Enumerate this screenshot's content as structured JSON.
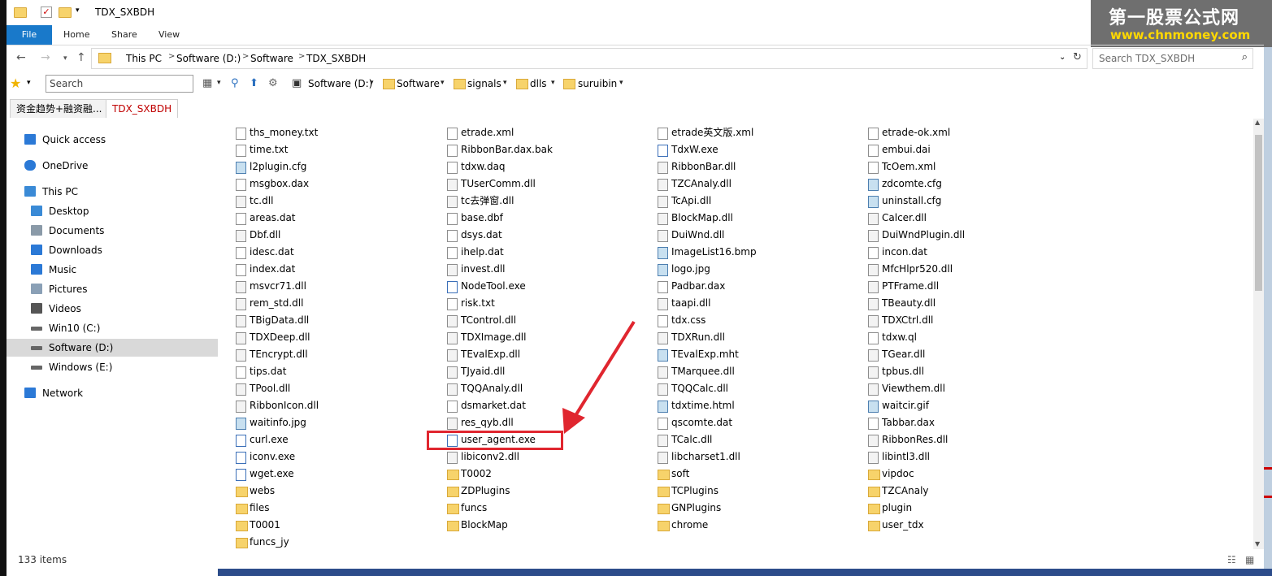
{
  "window": {
    "title": "TDX_SXBDH"
  },
  "ribbon": {
    "tabs": [
      "File",
      "Home",
      "Share",
      "View"
    ]
  },
  "address": {
    "crumbs": [
      "This PC",
      "Software (D:)",
      "Software",
      "TDX_SXBDH"
    ],
    "search_placeholder": "Search TDX_SXBDH"
  },
  "toolbar": {
    "search": "Search",
    "locations": [
      "Software (D:)",
      "Software",
      "signals",
      "dlls",
      "suruibin"
    ]
  },
  "folder_tabs": [
    "资金趋势+融资融...",
    "TDX_SXBDH"
  ],
  "nav": {
    "items": [
      {
        "label": "Quick access",
        "icon": "star-icon"
      },
      {
        "label": "OneDrive",
        "icon": "cloud-icon"
      },
      {
        "label": "This PC",
        "icon": "computer-icon"
      },
      {
        "label": "Desktop",
        "icon": "desktop-icon"
      },
      {
        "label": "Documents",
        "icon": "documents-icon"
      },
      {
        "label": "Downloads",
        "icon": "download-icon"
      },
      {
        "label": "Music",
        "icon": "music-icon"
      },
      {
        "label": "Pictures",
        "icon": "pictures-icon"
      },
      {
        "label": "Videos",
        "icon": "videos-icon"
      },
      {
        "label": "Win10 (C:)",
        "icon": "drive-icon"
      },
      {
        "label": "Software (D:)",
        "icon": "drive-icon"
      },
      {
        "label": "Windows (E:)",
        "icon": "drive-icon"
      },
      {
        "label": "Network",
        "icon": "network-icon"
      }
    ],
    "selected": "Software (D:)"
  },
  "files": {
    "columns": [
      [
        {
          "name": "ths_money.txt",
          "type": "file"
        },
        {
          "name": "time.txt",
          "type": "file"
        },
        {
          "name": "l2plugin.cfg",
          "type": "img"
        },
        {
          "name": "msgbox.dax",
          "type": "file"
        },
        {
          "name": "tc.dll",
          "type": "dll"
        },
        {
          "name": "areas.dat",
          "type": "file"
        },
        {
          "name": "Dbf.dll",
          "type": "dll"
        },
        {
          "name": "idesc.dat",
          "type": "file"
        },
        {
          "name": "index.dat",
          "type": "file"
        },
        {
          "name": "msvcr71.dll",
          "type": "dll"
        },
        {
          "name": "rem_std.dll",
          "type": "dll"
        },
        {
          "name": "TBigData.dll",
          "type": "dll"
        },
        {
          "name": "TDXDeep.dll",
          "type": "dll"
        },
        {
          "name": "TEncrypt.dll",
          "type": "dll"
        },
        {
          "name": "tips.dat",
          "type": "file"
        },
        {
          "name": "TPool.dll",
          "type": "dll"
        },
        {
          "name": "RibbonIcon.dll",
          "type": "dll"
        },
        {
          "name": "waitinfo.jpg",
          "type": "img"
        },
        {
          "name": "curl.exe",
          "type": "exe"
        },
        {
          "name": "iconv.exe",
          "type": "exe"
        },
        {
          "name": "wget.exe",
          "type": "exe"
        },
        {
          "name": "webs",
          "type": "folder"
        },
        {
          "name": "files",
          "type": "folder"
        },
        {
          "name": "T0001",
          "type": "folder"
        },
        {
          "name": "funcs_jy",
          "type": "folder"
        }
      ],
      [
        {
          "name": "etrade.xml",
          "type": "file"
        },
        {
          "name": "RibbonBar.dax.bak",
          "type": "file"
        },
        {
          "name": "tdxw.daq",
          "type": "file"
        },
        {
          "name": "TUserComm.dll",
          "type": "dll"
        },
        {
          "name": "tc去弹窗.dll",
          "type": "dll"
        },
        {
          "name": "base.dbf",
          "type": "file"
        },
        {
          "name": "dsys.dat",
          "type": "file"
        },
        {
          "name": "ihelp.dat",
          "type": "file"
        },
        {
          "name": "invest.dll",
          "type": "dll"
        },
        {
          "name": "NodeTool.exe",
          "type": "exe"
        },
        {
          "name": "risk.txt",
          "type": "file"
        },
        {
          "name": "TControl.dll",
          "type": "dll"
        },
        {
          "name": "TDXImage.dll",
          "type": "dll"
        },
        {
          "name": "TEvalExp.dll",
          "type": "dll"
        },
        {
          "name": "TJyaid.dll",
          "type": "dll"
        },
        {
          "name": "TQQAnaly.dll",
          "type": "dll"
        },
        {
          "name": "dsmarket.dat",
          "type": "file"
        },
        {
          "name": "res_qyb.dll",
          "type": "dll"
        },
        {
          "name": "user_agent.exe",
          "type": "exe"
        },
        {
          "name": "libiconv2.dll",
          "type": "dll"
        },
        {
          "name": "T0002",
          "type": "folder"
        },
        {
          "name": "ZDPlugins",
          "type": "folder"
        },
        {
          "name": "funcs",
          "type": "folder"
        },
        {
          "name": "BlockMap",
          "type": "folder"
        }
      ],
      [
        {
          "name": "etrade英文版.xml",
          "type": "file"
        },
        {
          "name": "TdxW.exe",
          "type": "exe"
        },
        {
          "name": "RibbonBar.dll",
          "type": "dll"
        },
        {
          "name": "TZCAnaly.dll",
          "type": "dll"
        },
        {
          "name": "TcApi.dll",
          "type": "dll"
        },
        {
          "name": "BlockMap.dll",
          "type": "dll"
        },
        {
          "name": "DuiWnd.dll",
          "type": "dll"
        },
        {
          "name": "ImageList16.bmp",
          "type": "img"
        },
        {
          "name": "logo.jpg",
          "type": "img"
        },
        {
          "name": "Padbar.dax",
          "type": "file"
        },
        {
          "name": "taapi.dll",
          "type": "dll"
        },
        {
          "name": "tdx.css",
          "type": "file"
        },
        {
          "name": "TDXRun.dll",
          "type": "dll"
        },
        {
          "name": "TEvalExp.mht",
          "type": "img"
        },
        {
          "name": "TMarquee.dll",
          "type": "dll"
        },
        {
          "name": "TQQCalc.dll",
          "type": "dll"
        },
        {
          "name": "tdxtime.html",
          "type": "img"
        },
        {
          "name": "qscomte.dat",
          "type": "file"
        },
        {
          "name": "TCalc.dll",
          "type": "dll"
        },
        {
          "name": "libcharset1.dll",
          "type": "dll"
        },
        {
          "name": "soft",
          "type": "folder"
        },
        {
          "name": "TCPlugins",
          "type": "folder"
        },
        {
          "name": "GNPlugins",
          "type": "folder"
        },
        {
          "name": "chrome",
          "type": "folder"
        }
      ],
      [
        {
          "name": "etrade-ok.xml",
          "type": "file"
        },
        {
          "name": "embui.dai",
          "type": "file"
        },
        {
          "name": "TcOem.xml",
          "type": "file"
        },
        {
          "name": "zdcomte.cfg",
          "type": "img"
        },
        {
          "name": "uninstall.cfg",
          "type": "img"
        },
        {
          "name": "Calcer.dll",
          "type": "dll"
        },
        {
          "name": "DuiWndPlugin.dll",
          "type": "dll"
        },
        {
          "name": "incon.dat",
          "type": "file"
        },
        {
          "name": "MfcHlpr520.dll",
          "type": "dll"
        },
        {
          "name": "PTFrame.dll",
          "type": "dll"
        },
        {
          "name": "TBeauty.dll",
          "type": "dll"
        },
        {
          "name": "TDXCtrl.dll",
          "type": "dll"
        },
        {
          "name": "tdxw.ql",
          "type": "file"
        },
        {
          "name": "TGear.dll",
          "type": "dll"
        },
        {
          "name": "tpbus.dll",
          "type": "dll"
        },
        {
          "name": "Viewthem.dll",
          "type": "dll"
        },
        {
          "name": "waitcir.gif",
          "type": "img"
        },
        {
          "name": "Tabbar.dax",
          "type": "file"
        },
        {
          "name": "RibbonRes.dll",
          "type": "dll"
        },
        {
          "name": "libintl3.dll",
          "type": "dll"
        },
        {
          "name": "vipdoc",
          "type": "folder"
        },
        {
          "name": "TZCAnaly",
          "type": "folder"
        },
        {
          "name": "plugin",
          "type": "folder"
        },
        {
          "name": "user_tdx",
          "type": "folder"
        }
      ]
    ],
    "col_start_rows": [
      0,
      0,
      0,
      0
    ]
  },
  "status": {
    "items_count": "133 items"
  },
  "watermark": {
    "line1": "第一股票公式网",
    "line2": "www.chnmoney.com"
  },
  "colors": {
    "accent": "#1979ca",
    "highlight_box": "#e0262f",
    "active_tab_text": "#c00000"
  }
}
